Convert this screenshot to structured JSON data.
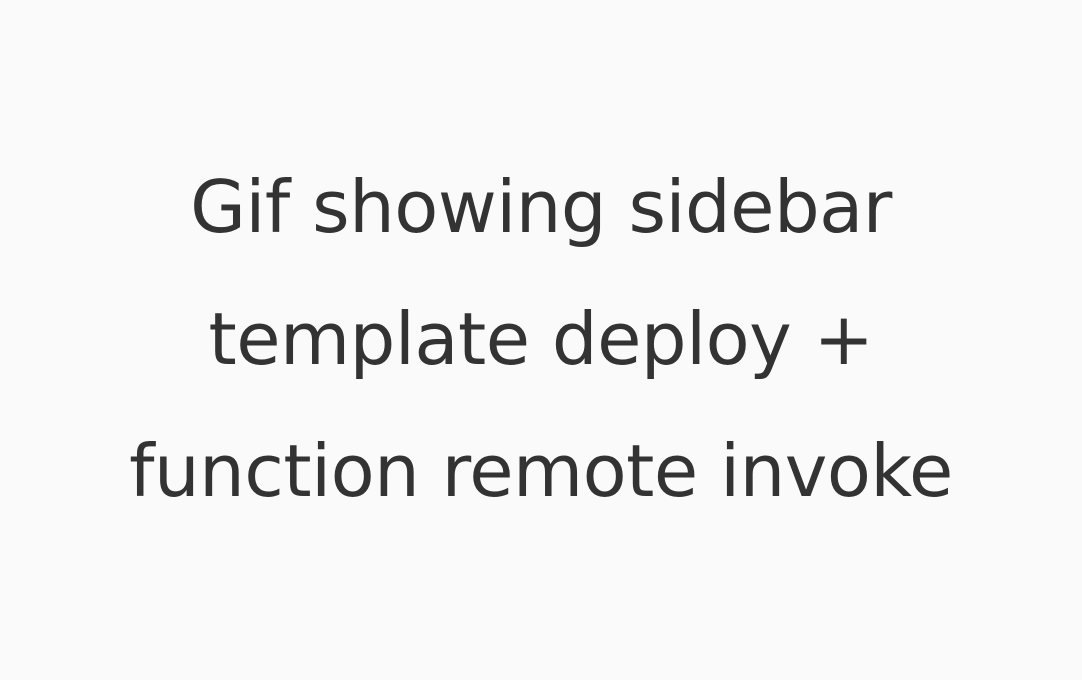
{
  "placeholder": {
    "lines": [
      "Gif showing sidebar",
      "template deploy +",
      "function remote invoke"
    ],
    "text_color": "#333333",
    "background_color": "#fafafa"
  }
}
